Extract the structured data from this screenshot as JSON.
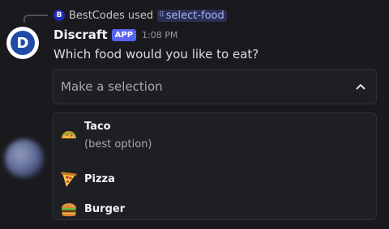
{
  "reply": {
    "avatar_letter": "B",
    "username": "BestCodes",
    "verb": "used",
    "command_icon": "⠿",
    "command": "select-food"
  },
  "message": {
    "bot_avatar_letter": "D",
    "bot_name": "Discraft",
    "badge": "APP",
    "timestamp": "1:08 PM",
    "text": "Which food would you like to eat?"
  },
  "select": {
    "placeholder": "Make a selection",
    "icon": "chevron-up-icon",
    "options": [
      {
        "emoji": "taco-icon",
        "label": "Taco",
        "description": "(best option)"
      },
      {
        "emoji": "pizza-icon",
        "label": "Pizza"
      },
      {
        "emoji": "burger-icon",
        "label": "Burger"
      }
    ]
  },
  "colors": {
    "background": "#1a1a1e",
    "accent": "#5865f2",
    "command_bg": "#2b2f52",
    "command_text": "#a6b2ff"
  }
}
